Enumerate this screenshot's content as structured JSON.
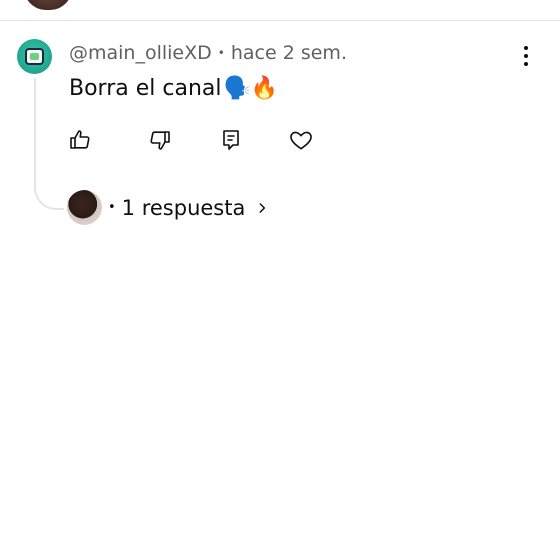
{
  "comment": {
    "author": "@main_ollieXD",
    "separator": "•",
    "time": "hace 2 sem.",
    "text": "Borra el canal",
    "emojis": "🗣️🔥"
  },
  "actions": {
    "like_icon": "thumbs-up-icon",
    "dislike_icon": "thumbs-down-icon",
    "reply_icon": "comment-icon",
    "heart_icon": "heart-icon",
    "more_icon": "more-vertical-icon"
  },
  "replies": {
    "separator": "•",
    "label": "1 respuesta",
    "chevron_icon": "chevron-right-icon"
  }
}
